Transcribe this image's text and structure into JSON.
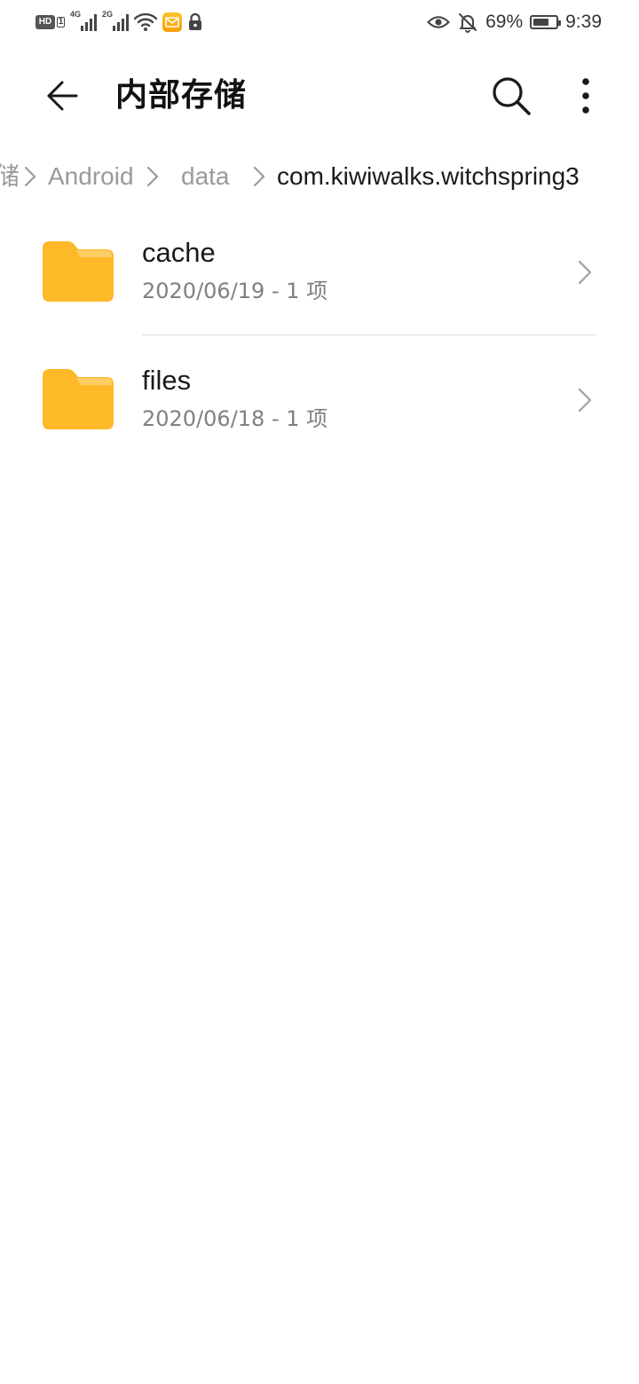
{
  "status_bar": {
    "hd_badge": "HD",
    "sim_slot": "1",
    "sim1_network": "4G",
    "sim2_network": "2G",
    "battery_percent": "69%",
    "battery_level": 0.69,
    "time": "9:39",
    "icons": [
      "hd-icon",
      "signal-icon",
      "signal-icon",
      "wifi-icon",
      "mail-notification-icon",
      "lock-icon",
      "eye-icon",
      "bell-off-icon",
      "battery-icon"
    ]
  },
  "app_bar": {
    "title": "内部存储",
    "back_icon": "arrow-left-icon",
    "search_icon": "search-icon",
    "more_icon": "more-vertical-icon"
  },
  "breadcrumb": {
    "items": [
      "储",
      "Android",
      "data",
      "com.kiwiwalks.witchspring3"
    ],
    "separator_icon": "chevron-right-icon"
  },
  "files": [
    {
      "name": "cache",
      "meta": "2020/06/19 - 1 项",
      "icon": "folder-icon"
    },
    {
      "name": "files",
      "meta": "2020/06/18 - 1 项",
      "icon": "folder-icon"
    }
  ],
  "colors": {
    "folder": "#FDB927",
    "folder_tab": "#FDD06A",
    "title_text": "#111111",
    "secondary_text": "#808080",
    "breadcrumb_inactive": "#9A9A9A"
  }
}
